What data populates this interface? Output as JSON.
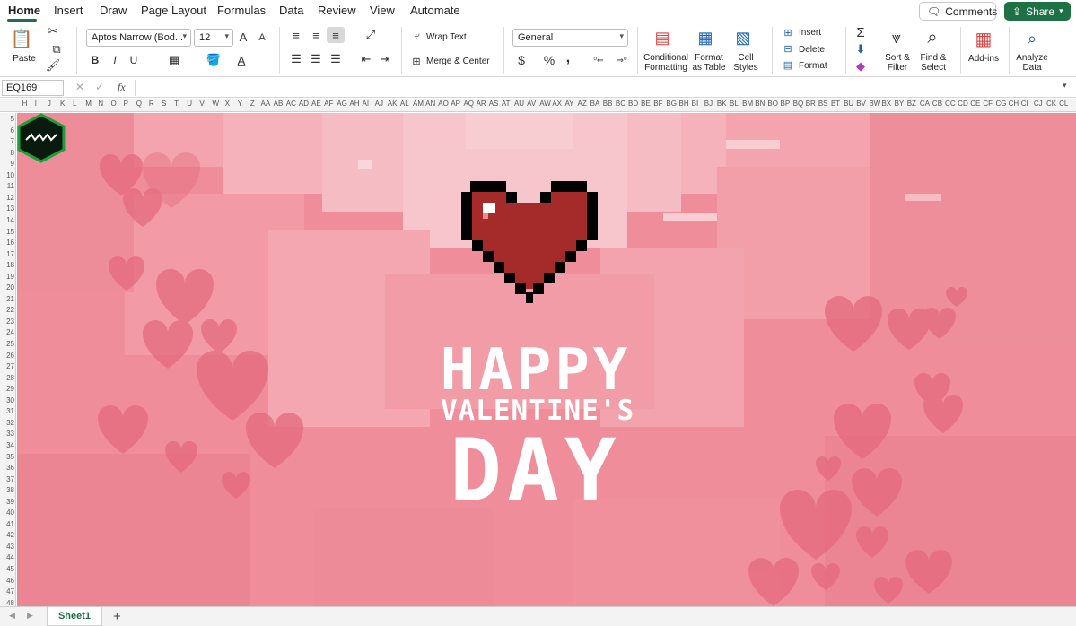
{
  "menu_tabs": [
    "Home",
    "Insert",
    "Draw",
    "Page Layout",
    "Formulas",
    "Data",
    "Review",
    "View",
    "Automate"
  ],
  "header_buttons": {
    "comments": "Comments",
    "share": "Share"
  },
  "ribbon": {
    "paste": "Paste",
    "font_name": "Aptos Narrow (Bod...",
    "font_size": "12",
    "bold": "B",
    "italic": "I",
    "underline": "U",
    "grow_font": "A",
    "shrink_font": "A",
    "wrap_text": "Wrap Text",
    "merge_center": "Merge & Center",
    "number_format": "General",
    "currency": "$",
    "percent": "%",
    "comma": ",",
    "conditional_formatting": [
      "Conditional",
      "Formatting"
    ],
    "format_as_table": [
      "Format",
      "as Table"
    ],
    "cell_styles": [
      "Cell",
      "Styles"
    ],
    "insert": "Insert",
    "delete": "Delete",
    "format": "Format",
    "sum": "Σ",
    "sort_filter": [
      "Sort &",
      "Filter"
    ],
    "find_select": [
      "Find &",
      "Select"
    ],
    "add_ins": "Add-ins",
    "analyze_data": [
      "Analyze",
      "Data"
    ]
  },
  "formula_bar": {
    "name_box": "EQ169",
    "fx": "fx",
    "value": ""
  },
  "columns": [
    "H",
    "I",
    "J",
    "K",
    "L",
    "M",
    "N",
    "O",
    "P",
    "Q",
    "R",
    "S",
    "T",
    "U",
    "V",
    "W",
    "X",
    "Y",
    "Z",
    "AA",
    "AB",
    "AC",
    "AD",
    "AE",
    "AF",
    "AG",
    "AH",
    "AI",
    "AJ",
    "AK",
    "AL",
    "AM",
    "AN",
    "AO",
    "AP",
    "AQ",
    "AR",
    "AS",
    "AT",
    "AU",
    "AV",
    "AW",
    "AX",
    "AY",
    "AZ",
    "BA",
    "BB",
    "BC",
    "BD",
    "BE",
    "BF",
    "BG",
    "BH",
    "BI",
    "BJ",
    "BK",
    "BL",
    "BM",
    "BN",
    "BO",
    "BP",
    "BQ",
    "BR",
    "BS",
    "BT",
    "BU",
    "BV",
    "BW",
    "BX",
    "BY",
    "BZ",
    "CA",
    "CB",
    "CC",
    "CD",
    "CE",
    "CF",
    "CG",
    "CH",
    "CI",
    "CJ",
    "CK",
    "CL"
  ],
  "rows": [
    "5",
    "6",
    "7",
    "8",
    "9",
    "10",
    "11",
    "12",
    "13",
    "14",
    "15",
    "16",
    "17",
    "18",
    "19",
    "20",
    "21",
    "22",
    "23",
    "24",
    "25",
    "26",
    "27",
    "28",
    "29",
    "30",
    "31",
    "32",
    "33",
    "34",
    "35",
    "36",
    "37",
    "38",
    "39",
    "40",
    "41",
    "42",
    "43",
    "44",
    "45",
    "46",
    "47",
    "48"
  ],
  "artwork": {
    "line1": "HAPPY",
    "line2": "VALENTINE'S",
    "line3": "DAY",
    "heart_color": "#a52a2a",
    "background_color": "#f08e9b",
    "logo_color": "#1aa23a"
  },
  "sheets": [
    "Sheet1"
  ],
  "add_sheet": "+"
}
